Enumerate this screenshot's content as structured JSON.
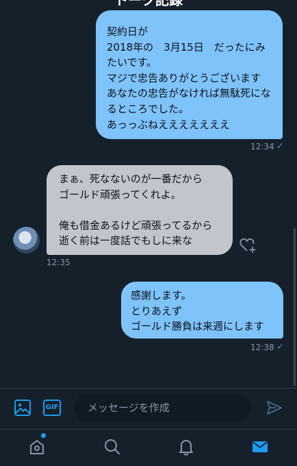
{
  "header": {
    "title": "トーク記録"
  },
  "messages": [
    {
      "side": "sent",
      "text": "契約日が\n2018年の　3月15日　だったにみたいです。\nマジで忠告ありがとうございます\nあなたの忠告がなければ無駄死になるところでした。\nあっっぶねえええええええ",
      "time": "12:34"
    },
    {
      "side": "recv",
      "text": "まぁ、死なないのが一番だから\nゴールド頑張ってくれよ。\n\n俺も借金あるけど頑張ってるから\n逝く前は一度話でもしに来な",
      "time": "12:35"
    },
    {
      "side": "sent",
      "text": "感謝します。\nとりあえず\nゴールド勝負は来週にします",
      "time": "12:38"
    }
  ],
  "composer": {
    "placeholder": "メッセージを作成",
    "gif_label": "GIF"
  },
  "icons": {
    "image": "image-icon",
    "gif": "gif-icon",
    "send": "send-icon",
    "heart": "heart-plus-icon",
    "home": "home-icon",
    "search": "search-icon",
    "notifications": "bell-icon",
    "messages": "mail-icon"
  },
  "colors": {
    "background": "#15202b",
    "sent_bubble": "#7fc3fb",
    "recv_bubble": "#c0c6cc",
    "accent": "#1d9bf0"
  }
}
